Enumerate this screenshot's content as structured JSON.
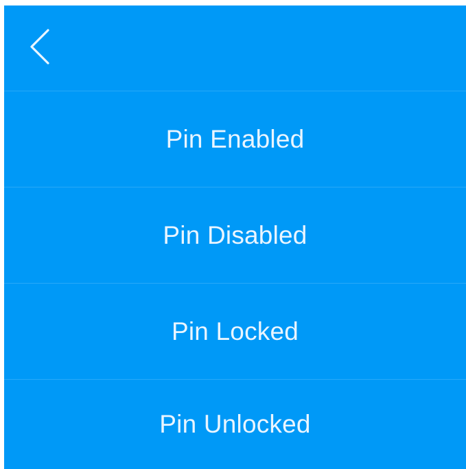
{
  "header": {
    "back_icon": "chevron-left-icon"
  },
  "menu": {
    "items": [
      {
        "label": "Pin Enabled"
      },
      {
        "label": "Pin Disabled"
      },
      {
        "label": "Pin Locked"
      },
      {
        "label": "Pin Unlocked"
      }
    ]
  },
  "colors": {
    "background": "#0099f7",
    "text": "#e9f5ff"
  }
}
